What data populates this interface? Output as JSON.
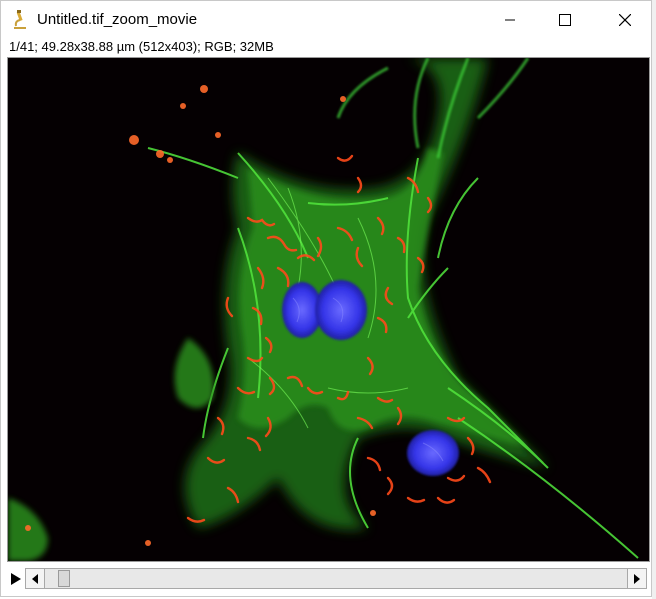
{
  "window": {
    "title": "Untitled.tif_zoom_movie",
    "app_icon": "imagej-microscope-icon",
    "buttons": [
      {
        "name": "minimize-button",
        "icon": "minimize-icon"
      },
      {
        "name": "maximize-button",
        "icon": "maximize-icon"
      },
      {
        "name": "close-button",
        "icon": "close-icon"
      }
    ]
  },
  "info": {
    "text": "1/41; 49.28x38.88 µm (512x403); RGB; 32MB"
  },
  "image": {
    "description_channels": [
      "actin-green",
      "mitochondria-red",
      "nucleus-blue"
    ],
    "background_color": "#050002"
  },
  "controls": {
    "play_icon": "play-icon",
    "scroll_left_icon": "arrow-left-icon",
    "scroll_right_icon": "arrow-right-icon",
    "frame_position": 0.024
  },
  "colors": {
    "actin": "#3fd63a",
    "mitochondria": "#ff4a1a",
    "nucleus": "#3a3aff"
  }
}
